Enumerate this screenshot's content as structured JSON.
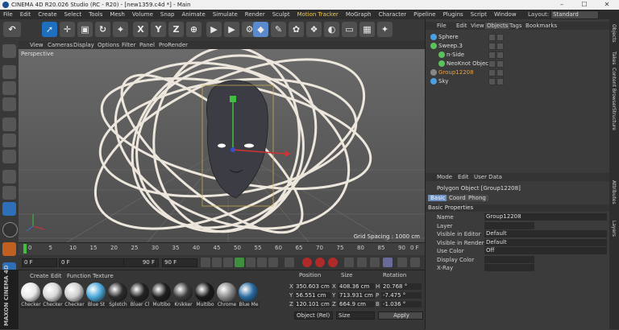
{
  "window": {
    "title": "CINEMA 4D R20.026 Studio (RC - R20) - [new1359.c4d *] - Main"
  },
  "menubar": {
    "items": [
      "File",
      "Edit",
      "Create",
      "Select",
      "Tools",
      "Mesh",
      "Volume",
      "Snap",
      "Animate",
      "Simulate",
      "Render",
      "Sculpt",
      "Motion Tracker",
      "MoGraph",
      "Character",
      "Pipeline",
      "Plugins",
      "Script",
      "Window"
    ],
    "highlighted": [
      "Motion Tracker"
    ],
    "layout_label": "Layout:",
    "layout_value": "Standard"
  },
  "viewport": {
    "menu": [
      "View",
      "Cameras",
      "Display",
      "Options",
      "Filter",
      "Panel",
      "ProRender"
    ],
    "camera": "Perspective",
    "grid_spacing": "Grid Spacing : 1000 cm"
  },
  "timeline": {
    "ticks": [
      "0",
      "5",
      "10",
      "15",
      "20",
      "25",
      "30",
      "35",
      "40",
      "45",
      "50",
      "55",
      "60",
      "65",
      "70",
      "75",
      "80",
      "85",
      "90"
    ],
    "end_label": "0 F"
  },
  "playbar": {
    "current_frame": "0 F",
    "start_frame": "0 F",
    "end_frame": "90 F",
    "max_frame": "90 F"
  },
  "materials": {
    "menu": [
      "Create",
      "Edit",
      "Function",
      "Texture"
    ],
    "items": [
      {
        "label": "Checker",
        "color": "#e8e8e8"
      },
      {
        "label": "Checker",
        "color": "#d8d8d8"
      },
      {
        "label": "Checker",
        "color": "#cfcfcf"
      },
      {
        "label": "Blue St",
        "color": "#4aa8d8"
      },
      {
        "label": "Splotch",
        "color": "#2b2b2b"
      },
      {
        "label": "Bluer Cl",
        "color": "#222222"
      },
      {
        "label": "Multibo",
        "color": "#1e1e1e"
      },
      {
        "label": "Knikker",
        "color": "#3a3a3a"
      },
      {
        "label": "Multibo",
        "color": "#1a1a1a"
      },
      {
        "label": "Chrome",
        "color": "#8a8a8a"
      },
      {
        "label": "Blue Me",
        "color": "#2a6aa0"
      }
    ]
  },
  "coordinates": {
    "headers": [
      "Position",
      "Size",
      "Rotation"
    ],
    "rows": [
      {
        "axis": "X",
        "pos": "350.603 cm",
        "size_axis": "X",
        "size": "408.36 cm",
        "rot_axis": "H",
        "rot": "20.768 °"
      },
      {
        "axis": "Y",
        "pos": "56.551 cm",
        "size_axis": "Y",
        "size": "713.931 cm",
        "rot_axis": "P",
        "rot": "-7.475 °"
      },
      {
        "axis": "Z",
        "pos": "120.101 cm",
        "size_axis": "Z",
        "size": "664.9 cm",
        "rot_axis": "B",
        "rot": "-1.036 °"
      }
    ],
    "mode": "Object (Rel)",
    "size_mode": "Size",
    "apply": "Apply"
  },
  "objects": {
    "menu": [
      "File",
      "Edit",
      "View",
      "Objects",
      "Tags",
      "Bookmarks"
    ],
    "active_tab": "Objects",
    "rows": [
      {
        "name": "Sphere",
        "indent": 0,
        "highlight": false,
        "icon_color": "#4aa0e0"
      },
      {
        "name": "Sweep.3",
        "indent": 0,
        "highlight": false,
        "icon_color": "#5cc05c"
      },
      {
        "name": "n-Side",
        "indent": 1,
        "highlight": false,
        "icon_color": "#5cc05c"
      },
      {
        "name": "NeoKnot Object",
        "indent": 1,
        "highlight": false,
        "icon_color": "#5cc05c"
      },
      {
        "name": "Group12208",
        "indent": 0,
        "highlight": true,
        "icon_color": "#888888"
      },
      {
        "name": "Sky",
        "indent": 0,
        "highlight": false,
        "icon_color": "#4aa0e0"
      }
    ]
  },
  "attributes": {
    "menu": [
      "Mode",
      "Edit",
      "User Data"
    ],
    "object_title": "Polygon Object [Group12208]",
    "tabs": [
      "Basic",
      "Coord.",
      "Phong"
    ],
    "active_tab": "Basic",
    "section": "Basic Properties",
    "fields": [
      {
        "label": "Name",
        "value": "Group12208"
      },
      {
        "label": "Layer",
        "value": ""
      },
      {
        "label": "Visible in Editor",
        "value": "Default"
      },
      {
        "label": "Visible in Renderer",
        "value": "Default"
      },
      {
        "label": "Use Color",
        "value": "Off"
      },
      {
        "label": "Display Color",
        "value": ""
      },
      {
        "label": "X-Ray",
        "value": ""
      }
    ]
  },
  "side_tabs": [
    "Objects",
    "Takes",
    "Content Browser",
    "Structure",
    "Attributes",
    "Layers"
  ]
}
